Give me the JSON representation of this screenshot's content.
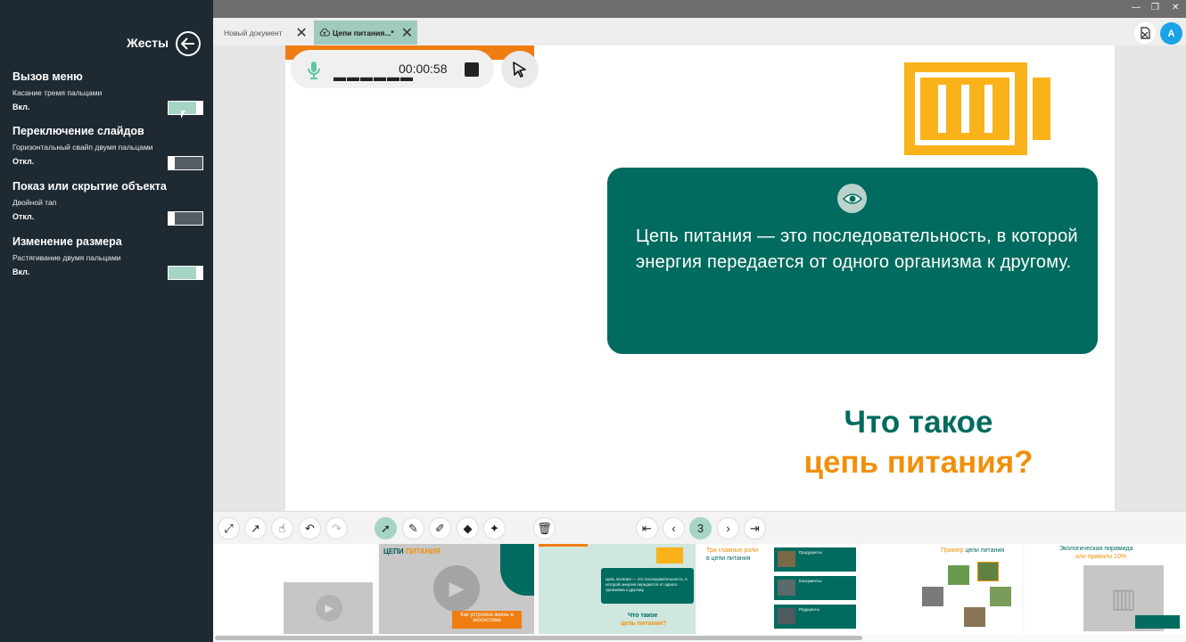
{
  "panel": {
    "title": "Жесты",
    "gestures": [
      {
        "title": "Вызов меню",
        "desc": "Касание тремя пальцами",
        "state": "Вкл.",
        "on": true
      },
      {
        "title": "Переключение слайдов",
        "desc": "Горизонтальный свайп двумя пальцами",
        "state": "Откл.",
        "on": false
      },
      {
        "title": "Показ или скрытие объекта",
        "desc": "Двойной тап",
        "state": "Откл.",
        "on": false
      },
      {
        "title": "Изменение размера",
        "desc": "Растягивание двумя пальцами",
        "state": "Вкл.",
        "on": true
      }
    ]
  },
  "tabs": [
    {
      "label": "Новый документ"
    },
    {
      "label": "Цепи питания...*"
    }
  ],
  "user": {
    "avatar_letter": "A"
  },
  "recorder": {
    "dashes": "▬▬▬▬▬▬",
    "time": "00:00:58"
  },
  "slide": {
    "definition": "Цепь питания — это последовательность, в которой энергия передается от одного организма к другому.",
    "question_line1": "Что такое",
    "question_line2": "цепь питания?"
  },
  "toolbar": {
    "page": "3"
  },
  "thumbnails": {
    "t2_title_a": "ЦЕПИ",
    "t2_title_b": "ПИТАНИЯ",
    "t2_caption": "Как устроена жизнь в экосистеме",
    "t3_text": "Цепь питания — это последовательность, в которой энергия передается от одного организма к другому.",
    "t3_q1": "Что такое",
    "t3_q2": "цепь питания?",
    "t4_title_a": "Три главные роли",
    "t4_title_b": "в цепи питания",
    "t4_roles": [
      "Продуценты",
      "Консументы",
      "Редуценты"
    ],
    "t5_title_a": "Пример",
    "t5_title_b": "цепи питания",
    "t6_title_a": "Экологическая пирамида",
    "t6_title_b": "или правило 10%"
  }
}
